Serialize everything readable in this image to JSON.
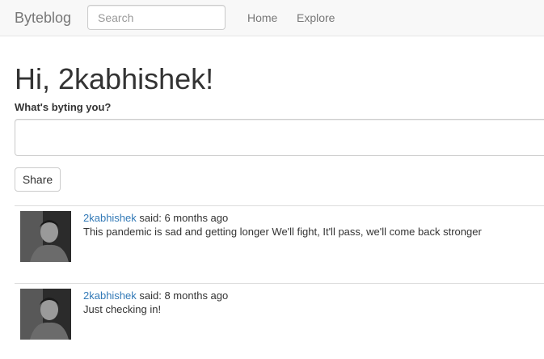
{
  "navbar": {
    "brand": "Byteblog",
    "search_placeholder": "Search",
    "links": [
      "Home",
      "Explore"
    ]
  },
  "main": {
    "greeting": "Hi, 2kabhishek!",
    "prompt_label": "What's byting you?",
    "post_value": "",
    "share_label": "Share"
  },
  "posts": [
    {
      "author": "2kabhishek",
      "said": " said: ",
      "time": "6 months ago",
      "body": "This pandemic is sad and getting longer We'll fight, It'll pass, we'll come back stronger",
      "avatar_icon": "user-photo-icon"
    },
    {
      "author": "2kabhishek",
      "said": " said: ",
      "time": "8 months ago",
      "body": "Just checking in!",
      "avatar_icon": "user-photo-icon"
    }
  ],
  "colors": {
    "navbar_bg": "#f8f8f8",
    "link": "#337ab7",
    "nav_text": "#777777",
    "text": "#333333"
  }
}
